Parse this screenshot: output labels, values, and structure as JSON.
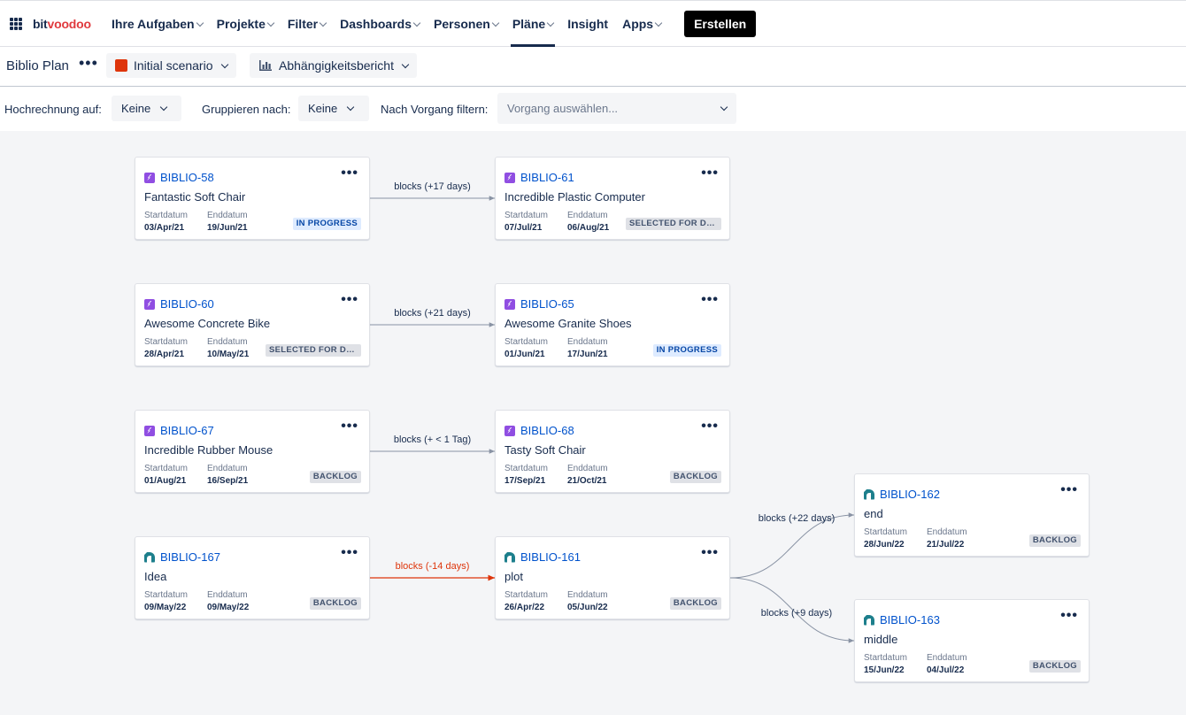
{
  "brand": {
    "logo_a": "bit",
    "logo_b": "voodoo",
    "accent": "#e03a3e"
  },
  "nav": {
    "items": [
      {
        "label": "Ihre Aufgaben",
        "dropdown": true
      },
      {
        "label": "Projekte",
        "dropdown": true
      },
      {
        "label": "Filter",
        "dropdown": true
      },
      {
        "label": "Dashboards",
        "dropdown": true
      },
      {
        "label": "Personen",
        "dropdown": true
      },
      {
        "label": "Pläne",
        "dropdown": true,
        "active": true
      },
      {
        "label": "Insight",
        "dropdown": false
      },
      {
        "label": "Apps",
        "dropdown": true
      }
    ],
    "create_label": "Erstellen"
  },
  "plan": {
    "title": "Biblio Plan",
    "more_icon": "more-icon",
    "scenario_label": "Initial scenario",
    "scenario_color": "#de350b",
    "report_label": "Abhängigkeitsbericht"
  },
  "filters": {
    "rollup_label": "Hochrechnung auf:",
    "rollup_value": "Keine",
    "group_label": "Gruppieren nach:",
    "group_value": "Keine",
    "issue_filter_label": "Nach Vorgang filtern:",
    "issue_filter_placeholder": "Vorgang auswählen..."
  },
  "card_labels": {
    "start": "Startdatum",
    "end": "Enddatum"
  },
  "cards": [
    {
      "key": "BIBLIO-58",
      "type": "epic",
      "summary": "Fantastic Soft Chair",
      "start": "03/Apr/21",
      "end": "19/Jun/21",
      "status": "IN PROGRESS",
      "status_type": "progress"
    },
    {
      "key": "BIBLIO-61",
      "type": "epic",
      "summary": "Incredible Plastic Computer",
      "start": "07/Jul/21",
      "end": "06/Aug/21",
      "status": "SELECTED FOR DEVELOPMENT",
      "status_type": "selected"
    },
    {
      "key": "BIBLIO-60",
      "type": "epic",
      "summary": "Awesome Concrete Bike",
      "start": "28/Apr/21",
      "end": "10/May/21",
      "status": "SELECTED FOR DEVELOPMENT",
      "status_type": "selected"
    },
    {
      "key": "BIBLIO-65",
      "type": "epic",
      "summary": "Awesome Granite Shoes",
      "start": "01/Jun/21",
      "end": "17/Jun/21",
      "status": "IN PROGRESS",
      "status_type": "progress"
    },
    {
      "key": "BIBLIO-67",
      "type": "epic",
      "summary": "Incredible Rubber Mouse",
      "start": "01/Aug/21",
      "end": "16/Sep/21",
      "status": "BACKLOG",
      "status_type": "backlog"
    },
    {
      "key": "BIBLIO-68",
      "type": "epic",
      "summary": "Tasty Soft Chair",
      "start": "17/Sep/21",
      "end": "21/Oct/21",
      "status": "BACKLOG",
      "status_type": "backlog"
    },
    {
      "key": "BIBLIO-162",
      "type": "idea",
      "summary": "end",
      "start": "28/Jun/22",
      "end": "21/Jul/22",
      "status": "BACKLOG",
      "status_type": "backlog"
    },
    {
      "key": "BIBLIO-167",
      "type": "idea",
      "summary": "Idea",
      "start": "09/May/22",
      "end": "09/May/22",
      "status": "BACKLOG",
      "status_type": "backlog"
    },
    {
      "key": "BIBLIO-161",
      "type": "idea",
      "summary": "plot",
      "start": "26/Apr/22",
      "end": "05/Jun/22",
      "status": "BACKLOG",
      "status_type": "backlog"
    },
    {
      "key": "BIBLIO-163",
      "type": "idea",
      "summary": "middle",
      "start": "15/Jun/22",
      "end": "04/Jul/22",
      "status": "BACKLOG",
      "status_type": "backlog"
    }
  ],
  "links": [
    {
      "from": "BIBLIO-58",
      "to": "BIBLIO-61",
      "label": "blocks (+17 days)",
      "conflict": false
    },
    {
      "from": "BIBLIO-60",
      "to": "BIBLIO-65",
      "label": "blocks (+21 days)",
      "conflict": false
    },
    {
      "from": "BIBLIO-67",
      "to": "BIBLIO-68",
      "label": "blocks (+ < 1 Tag)",
      "conflict": false
    },
    {
      "from": "BIBLIO-161",
      "to": "BIBLIO-162",
      "label": "blocks (+22 days)",
      "conflict": false
    },
    {
      "from": "BIBLIO-167",
      "to": "BIBLIO-161",
      "label": "blocks (-14 days)",
      "conflict": true
    },
    {
      "from": "BIBLIO-161",
      "to": "BIBLIO-163",
      "label": "blocks (+9 days)",
      "conflict": false
    }
  ],
  "colors": {
    "link": "#8993a4",
    "conflict": "#de350b",
    "canvas": "#f4f5f7"
  }
}
